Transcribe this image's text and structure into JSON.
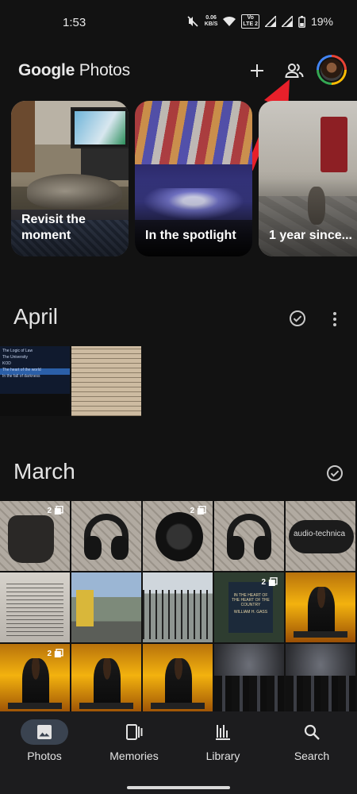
{
  "status_bar": {
    "time": "1:53",
    "net_speed_value": "0.06",
    "net_speed_unit": "KB/S",
    "volte_top": "Vo",
    "volte_bottom": "LTE 2",
    "battery_percent": "19%"
  },
  "header": {
    "logo_brand": "Google",
    "logo_product": "Photos",
    "icons": [
      "add-icon",
      "sharing-icon",
      "account-avatar"
    ]
  },
  "memories": [
    {
      "label_line1": "Revisit the",
      "label_line2": "moment"
    },
    {
      "label_line1": "In the spotlight",
      "label_line2": ""
    },
    {
      "label_line1": "1 year since...",
      "label_line2": ""
    }
  ],
  "sections": {
    "april": {
      "title": "April"
    },
    "march": {
      "title": "March"
    }
  },
  "april_thumb_text": {
    "line1": "The Logic of Law",
    "line2": "The University",
    "line3": "KOD",
    "line4": "The heart of the world",
    "line5": "In the fall of darkness"
  },
  "march_badges": {
    "pouch": "2",
    "earcup": "2",
    "poster": "2",
    "oscar": "2"
  },
  "march_text": {
    "brand": "audio-technica",
    "poster_title": "IN THE HEART OF THE HEART OF THE COUNTRY",
    "poster_author": "WILLIAM H. GASS"
  },
  "bottom_nav": [
    {
      "label": "Photos",
      "icon": "photo-icon",
      "active": true
    },
    {
      "label": "Memories",
      "icon": "memories-icon",
      "active": false
    },
    {
      "label": "Library",
      "icon": "library-icon",
      "active": false
    },
    {
      "label": "Search",
      "icon": "search-icon",
      "active": false
    }
  ],
  "colors": {
    "background": "#121212",
    "nav_background": "#1c1c1e",
    "active_pill": "#3a4350",
    "annotation_arrow": "#e8202a"
  }
}
